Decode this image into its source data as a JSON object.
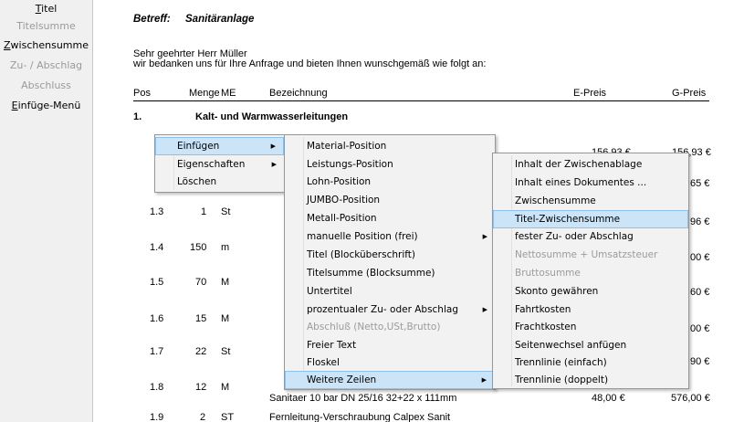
{
  "sidebar": {
    "items": [
      {
        "label": "Titel",
        "key": "T",
        "rest": "itel",
        "enabled": true
      },
      {
        "label": "Titelsumme",
        "enabled": false
      },
      {
        "label": "Zwischensumme",
        "key": "Z",
        "rest": "wischensumme",
        "enabled": true
      },
      {
        "label": "Zu- / Abschlag",
        "enabled": false
      },
      {
        "label": "Abschluss",
        "enabled": false
      },
      {
        "label": "Einfüge-Menü",
        "key": "E",
        "rest": "infüge-Menü",
        "enabled": true
      }
    ]
  },
  "doc": {
    "subject_label": "Betreff:",
    "subject_value": "Sanitäranlage",
    "greeting_1": "Sehr geehrter Herr Müller",
    "greeting_2": "wir bedanken uns für Ihre Anfrage  und bieten Ihnen wunschgemäß wie folgt an:",
    "columns": {
      "pos": "Pos",
      "menge": "Menge",
      "me": "ME",
      "bez": "Bezeichnung",
      "epreis": "E-Preis",
      "gpreis": "G-Preis"
    },
    "section_no": "1.",
    "section_title": "Kalt- und Warmwasserleitungen",
    "rows": [
      {
        "pos": "1.3",
        "menge": "1",
        "me": "St"
      },
      {
        "pos": "1.4",
        "menge": "150",
        "me": "m"
      },
      {
        "pos": "1.5",
        "menge": "70",
        "me": "M"
      },
      {
        "pos": "1.6",
        "menge": "15",
        "me": "M"
      },
      {
        "pos": "1.7",
        "menge": "22",
        "me": "St"
      },
      {
        "pos": "1.8",
        "menge": "12",
        "me": "M"
      },
      {
        "pos": "1.9",
        "menge": "2",
        "me": "ST"
      }
    ],
    "partial_prices": {
      "row1_e": "156,93 €",
      "row1_g": "156,93 €",
      "row2_g": "65 €",
      "row3_g": "96 €",
      "row4_g": "00 €",
      "row5_g": "60 €",
      "row6_g": "00 €",
      "row7_g": "90 €"
    },
    "row8_desc": "Sanitaer 10 bar DN 25/16  32+22 x 111mm",
    "row8_e": "48,00 €",
    "row8_g": "576,00 €",
    "row9_desc": "Fernleitung-Verschraubung Calpex Sanit"
  },
  "context_menu": {
    "items": [
      {
        "label": "Einfügen",
        "submenu": true,
        "highlighted": true
      },
      {
        "label": "Eigenschaften",
        "submenu": true
      },
      {
        "label": "Löschen",
        "submenu": false
      }
    ]
  },
  "insert_menu": {
    "items": [
      {
        "label": "Material-Position"
      },
      {
        "label": "Leistungs-Position"
      },
      {
        "label": "Lohn-Position"
      },
      {
        "label": "JUMBO-Position"
      },
      {
        "label": "Metall-Position"
      },
      {
        "label": "manuelle Position (frei)",
        "submenu": true
      },
      {
        "label": "Titel (Blocküberschrift)"
      },
      {
        "label": "Titelsumme (Blocksumme)"
      },
      {
        "label": "Untertitel"
      },
      {
        "label": "prozentualer Zu- oder Abschlag",
        "submenu": true
      },
      {
        "label": "Abschluß (Netto,USt,Brutto)",
        "disabled": true
      },
      {
        "label": "Freier Text"
      },
      {
        "label": "Floskel"
      },
      {
        "label": "Weitere Zeilen",
        "submenu": true,
        "highlighted": true
      }
    ]
  },
  "more_menu": {
    "items": [
      {
        "label": "Inhalt der Zwischenablage"
      },
      {
        "label": "Inhalt eines Dokumentes ..."
      },
      {
        "label": "Zwischensumme"
      },
      {
        "label": "Titel-Zwischensumme",
        "highlighted": true
      },
      {
        "label": "fester Zu- oder Abschlag"
      },
      {
        "label": "Nettosumme + Umsatzsteuer",
        "disabled": true
      },
      {
        "label": "Bruttosumme",
        "disabled": true
      },
      {
        "label": "Skonto gewähren"
      },
      {
        "label": "Fahrtkosten"
      },
      {
        "label": "Frachtkosten"
      },
      {
        "label": "Seitenwechsel anfügen"
      },
      {
        "label": "Trennlinie (einfach)"
      },
      {
        "label": "Trennlinie (doppelt)"
      }
    ]
  },
  "icons": {
    "submenu_arrow": "▶"
  }
}
